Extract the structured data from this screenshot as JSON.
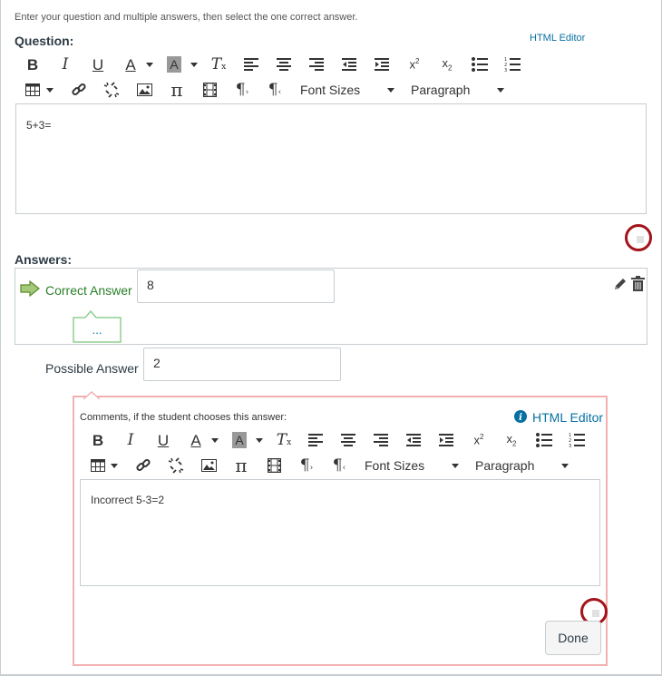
{
  "instructions": "Enter your question and multiple answers, then select the one correct answer.",
  "question": {
    "label": "Question:",
    "html_editor_link": "HTML Editor",
    "toolbar": {
      "font_sizes": "Font Sizes",
      "paragraph": "Paragraph"
    },
    "body_text": "5+3="
  },
  "answers": {
    "label": "Answers:",
    "correct": {
      "label": "Correct Answer",
      "value": "8",
      "comment_toggle": "..."
    },
    "possible": {
      "label": "Possible Answer",
      "value": "2"
    }
  },
  "comments": {
    "label": "Comments, if the student chooses this answer:",
    "html_editor_link": "HTML Editor",
    "toolbar": {
      "font_sizes": "Font Sizes",
      "paragraph": "Paragraph"
    },
    "body_text": "Incorrect 5-3=2",
    "done_label": "Done"
  },
  "colors": {
    "correct_green": "#2a7f2a",
    "link_blue": "#0770a3",
    "highlight_ring": "#a4121a",
    "comment_border": "#f3b0b0"
  }
}
